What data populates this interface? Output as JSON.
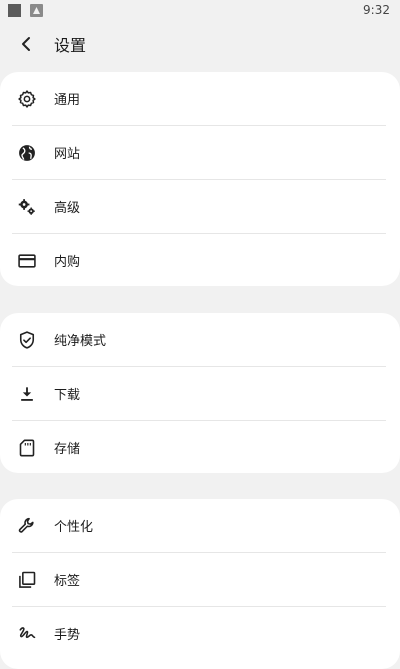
{
  "status_bar": {
    "time": "9:32"
  },
  "header": {
    "title": "设置"
  },
  "groups": [
    {
      "items": [
        {
          "label": "通用"
        },
        {
          "label": "网站"
        },
        {
          "label": "高级"
        },
        {
          "label": "内购"
        }
      ]
    },
    {
      "items": [
        {
          "label": "纯净模式"
        },
        {
          "label": "下载"
        },
        {
          "label": "存储"
        }
      ]
    },
    {
      "items": [
        {
          "label": "个性化"
        },
        {
          "label": "标签"
        },
        {
          "label": "手势"
        }
      ]
    }
  ],
  "icons": {
    "back": "arrow-back-icon",
    "general": "gear-icon",
    "website": "globe-icon",
    "advanced": "gears-icon",
    "purchase": "credit-card-icon",
    "clean_mode": "shield-check-icon",
    "download": "download-icon",
    "storage": "sd-card-icon",
    "personalize": "wrench-icon",
    "tabs": "tabs-icon",
    "gesture": "gesture-icon"
  }
}
